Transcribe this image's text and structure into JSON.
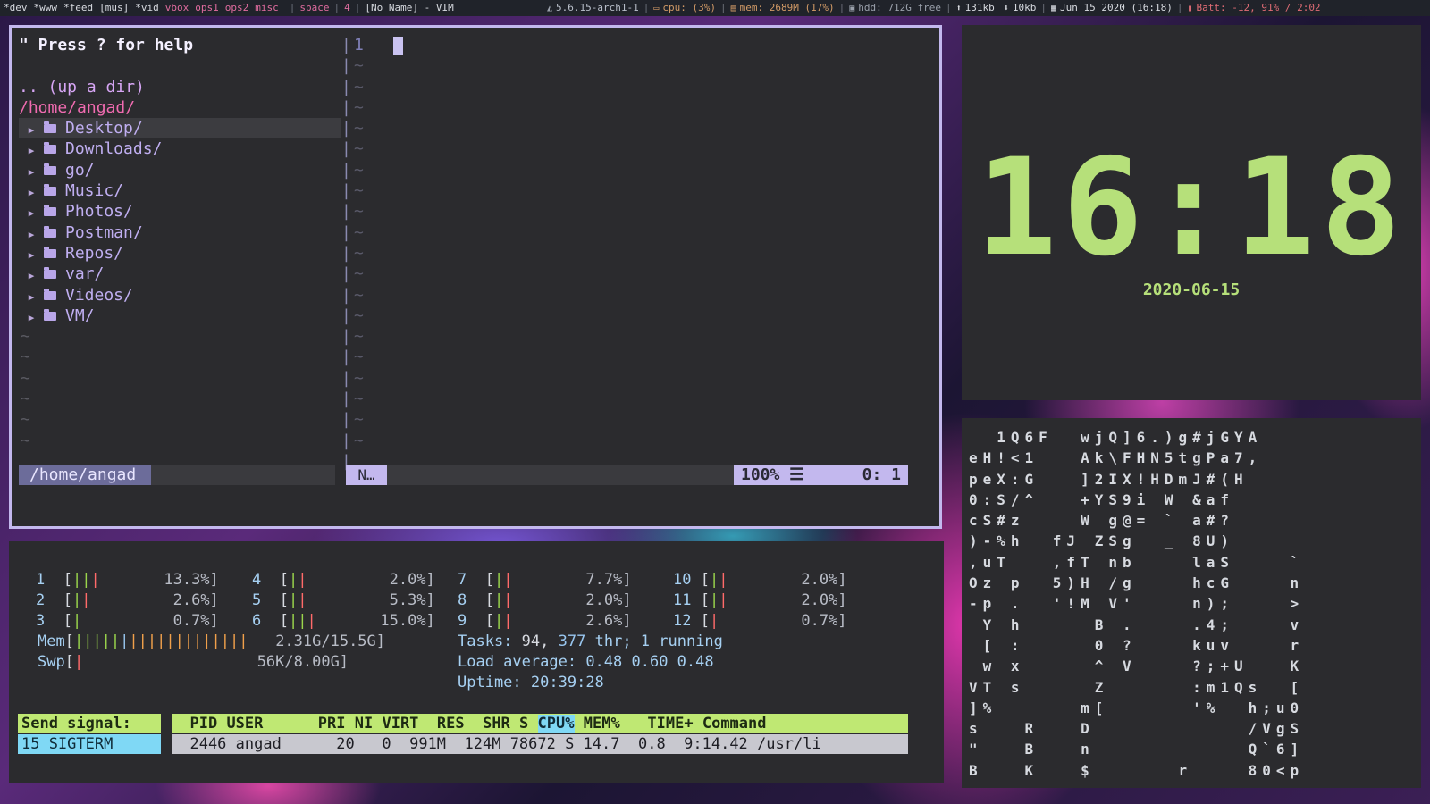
{
  "topbar": {
    "workspaces": [
      "*dev",
      "*www",
      "*feed",
      "[mus]",
      "*vid",
      "vbox",
      "ops1",
      "ops2",
      "misc"
    ],
    "space": "space",
    "count": "4",
    "window_title": "[No Name] - VIM",
    "kernel": "5.6.15-arch1-1",
    "cpu": "cpu: (3%)",
    "mem": "mem: 2689M (17%)",
    "hdd": "hdd: 712G free",
    "net_up": "131kb",
    "net_down": "10kb",
    "datetime": "Jun 15 2020 (16:18)",
    "battery": "Batt: -12, 91% / 2:02"
  },
  "vim": {
    "help": "\" Press ? for help",
    "updir": ".. (up a dir)",
    "root": "/home/angad/",
    "dirs": [
      "Desktop/",
      "Downloads/",
      "go/",
      "Music/",
      "Photos/",
      "Postman/",
      "Repos/",
      "var/",
      "Videos/",
      "VM/"
    ],
    "tilde": "~",
    "line_number": "1",
    "status_path": "/home/angad",
    "mode": "N…",
    "percent": "100% ☰",
    "position": "0:  1"
  },
  "htop": {
    "cpus": [
      {
        "n": "1",
        "pct": "13.3%]"
      },
      {
        "n": "2",
        "pct": "2.6%]"
      },
      {
        "n": "3",
        "pct": "0.7%]"
      },
      {
        "n": "4",
        "pct": "2.0%]"
      },
      {
        "n": "5",
        "pct": "5.3%]"
      },
      {
        "n": "6",
        "pct": "15.0%]"
      },
      {
        "n": "7",
        "pct": "7.7%]"
      },
      {
        "n": "8",
        "pct": "2.0%]"
      },
      {
        "n": "9",
        "pct": "2.6%]"
      },
      {
        "n": "10",
        "pct": "2.0%]"
      },
      {
        "n": "11",
        "pct": "2.0%]"
      },
      {
        "n": "12",
        "pct": "0.7%]"
      }
    ],
    "mem_label": "Mem",
    "mem_value": "2.31G/15.5G]",
    "swp_label": "Swp",
    "swp_value": "56K/8.00G]",
    "tasks_label": "Tasks:",
    "tasks_count": "94,",
    "threads_count": "377",
    "tasks_rest": "thr; 1 running",
    "load_label": "Load average:",
    "load_value": "0.48 0.60 0.48",
    "uptime_label": "Uptime:",
    "uptime_value": "20:39:28",
    "signal_header": "Send signal:",
    "signal_value": "15 SIGTERM",
    "header_cols": [
      "  PID",
      "USER    ",
      "  PRI",
      " NI",
      " VIRT",
      "  RES",
      "  SHR",
      "S",
      "CPU%",
      "MEM%",
      "  TIME+",
      " Command"
    ],
    "process": "  2446 angad      20   0  991M  124M 78672 S 14.7  0.8  9:14.42 /usr/li"
  },
  "clock": {
    "time": "16:18",
    "date": "2020-06-15"
  },
  "matrix": {
    "rows": [
      "  1Q6F  wjQ]6.)g#jGYA",
      "eH!<1   Ak\\FHN5tgPa7,",
      "peX:G   ]2IX!HDmJ#(H",
      "0:S/^   +YS9i W &af",
      "cS#z    W g@= ` a#?",
      ")-%h  fJ ZSg  _ 8U)",
      ",uT   ,fT nb    laS    `",
      "Oz p  5)H /g    hcG    n",
      "-p .  '!M V'    n);    >",
      " Y h     B .    .4;    v",
      " [ :     0 ?    kuv    r",
      " w x     ^ V    ?;+U   K",
      "VT s     Z      :m1Qs  [",
      "]%      m[      '%  h;u0",
      "s   R   D           /VgS",
      "\"   B   n           Q`6]",
      "B   K   $      r    80<p"
    ]
  }
}
